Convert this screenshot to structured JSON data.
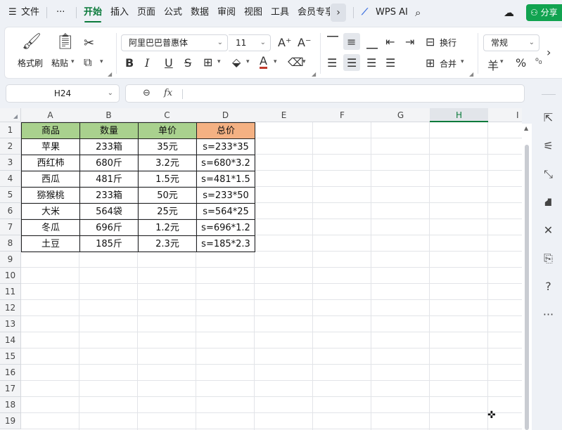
{
  "menubar": {
    "hamburger": "☰",
    "file": "文件",
    "more": "···",
    "tabs": [
      "开始",
      "插入",
      "页面",
      "公式",
      "数据",
      "审阅",
      "视图",
      "工具",
      "会员专享"
    ],
    "arrow": "›",
    "wps_ai": "WPS AI",
    "share": "分享"
  },
  "ribbon": {
    "format_painter": "格式刷",
    "paste": "粘贴",
    "font_name": "阿里巴巴普惠体",
    "font_size": "11",
    "font_grow": "A⁺",
    "font_shrink": "A⁻",
    "bold": "B",
    "italic": "I",
    "underline": "U",
    "strike": "S",
    "wrap": "换行",
    "merge": "合并",
    "number_format": "常规",
    "currency": "羊",
    "percent": "%"
  },
  "formula": {
    "name_box": "H24",
    "fx": "fx",
    "zoom": "⊖",
    "content": ""
  },
  "grid": {
    "columns": [
      "A",
      "B",
      "C",
      "D",
      "E",
      "F",
      "G",
      "H",
      "I"
    ],
    "selected_column": "H",
    "rows": [
      "1",
      "2",
      "3",
      "4",
      "5",
      "6",
      "7",
      "8",
      "9",
      "10",
      "11",
      "12",
      "13",
      "14",
      "15",
      "16",
      "17",
      "18",
      "19"
    ],
    "header": [
      "商品",
      "数量",
      "单价",
      "总价"
    ],
    "header_colors": [
      "#a9d18e",
      "#a9d18e",
      "#a9d18e",
      "#f4b183"
    ],
    "data": [
      [
        "苹果",
        "233箱",
        "35元",
        "s=233*35"
      ],
      [
        "西红柿",
        "680斤",
        "3.2元",
        "s=680*3.2"
      ],
      [
        "西瓜",
        "481斤",
        "1.5元",
        "s=481*1.5"
      ],
      [
        "猕猴桃",
        "233箱",
        "50元",
        "s=233*50"
      ],
      [
        "大米",
        "564袋",
        "25元",
        "s=564*25"
      ],
      [
        "冬瓜",
        "696斤",
        "1.2元",
        "s=696*1.2"
      ],
      [
        "土豆",
        "185斤",
        "2.3元",
        "s=185*2.3"
      ]
    ]
  }
}
